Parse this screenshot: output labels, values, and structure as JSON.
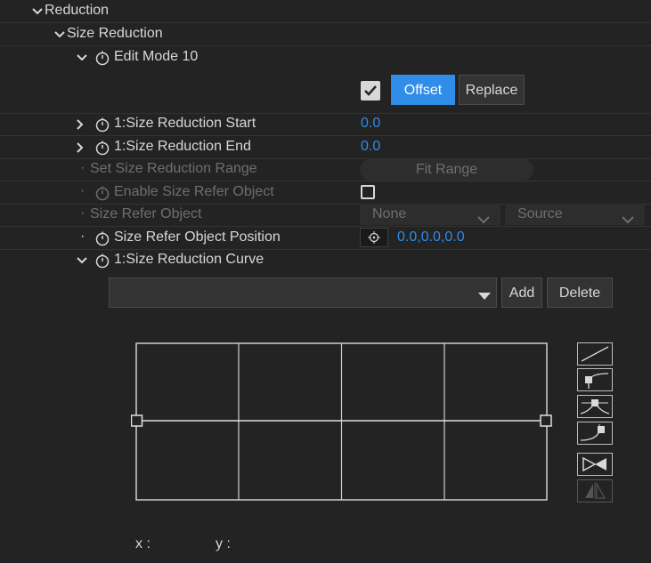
{
  "tree": {
    "reduction_label": "Reduction",
    "size_reduction_label": "Size Reduction",
    "edit_mode_label": "Edit Mode 10",
    "offset_label": "Offset",
    "replace_label": "Replace",
    "start_label": "1:Size Reduction Start",
    "start_value": "0.0",
    "end_label": "1:Size Reduction End",
    "end_value": "0.0",
    "set_range_label": "Set Size Reduction Range",
    "fit_range_label": "Fit Range",
    "enable_refer_label": "Enable Size Refer Object",
    "refer_object_label": "Size Refer Object",
    "refer_none_label": "None",
    "refer_source_label": "Source",
    "refer_position_label": "Size Refer Object Position",
    "refer_position_value": "0.0,0.0,0.0",
    "curve_label": "1:Size Reduction Curve"
  },
  "curve_panel": {
    "preset_value": "",
    "add_label": "Add",
    "delete_label": "Delete",
    "x_label": "x :",
    "y_label": "y :"
  },
  "colors": {
    "accent": "#2f8de8",
    "value": "#2d8ceb",
    "background": "#232323"
  },
  "icons": {
    "stopwatch": "stopwatch-icon",
    "expand": "chevron-down-icon",
    "collapse": "chevron-right-icon",
    "target": "crosshair-icon"
  }
}
